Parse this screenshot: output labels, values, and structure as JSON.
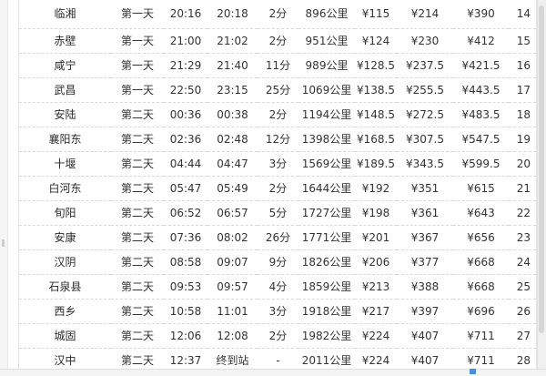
{
  "columns": [
    "station",
    "day",
    "arrive",
    "depart",
    "stop",
    "distance",
    "price1",
    "price2",
    "price3",
    "index"
  ],
  "rows": [
    {
      "station": "临湘",
      "day": "第一天",
      "arrive": "20:16",
      "depart": "20:18",
      "stop": "2分",
      "distance": "896公里",
      "price1": "¥115",
      "price2": "¥214",
      "price3": "¥390",
      "index": "14"
    },
    {
      "station": "赤壁",
      "day": "第一天",
      "arrive": "21:00",
      "depart": "21:02",
      "stop": "2分",
      "distance": "951公里",
      "price1": "¥124",
      "price2": "¥230",
      "price3": "¥412",
      "index": "15"
    },
    {
      "station": "咸宁",
      "day": "第一天",
      "arrive": "21:29",
      "depart": "21:40",
      "stop": "11分",
      "distance": "989公里",
      "price1": "¥128.5",
      "price2": "¥237.5",
      "price3": "¥421.5",
      "index": "16"
    },
    {
      "station": "武昌",
      "day": "第一天",
      "arrive": "22:50",
      "depart": "23:15",
      "stop": "25分",
      "distance": "1069公里",
      "price1": "¥138.5",
      "price2": "¥255.5",
      "price3": "¥443.5",
      "index": "17"
    },
    {
      "station": "安陆",
      "day": "第二天",
      "arrive": "00:36",
      "depart": "00:38",
      "stop": "2分",
      "distance": "1194公里",
      "price1": "¥148.5",
      "price2": "¥272.5",
      "price3": "¥483.5",
      "index": "18"
    },
    {
      "station": "襄阳东",
      "day": "第二天",
      "arrive": "02:36",
      "depart": "02:48",
      "stop": "12分",
      "distance": "1398公里",
      "price1": "¥168.5",
      "price2": "¥307.5",
      "price3": "¥547.5",
      "index": "19"
    },
    {
      "station": "十堰",
      "day": "第二天",
      "arrive": "04:44",
      "depart": "04:47",
      "stop": "3分",
      "distance": "1569公里",
      "price1": "¥189.5",
      "price2": "¥343.5",
      "price3": "¥599.5",
      "index": "20"
    },
    {
      "station": "白河东",
      "day": "第二天",
      "arrive": "05:47",
      "depart": "05:49",
      "stop": "2分",
      "distance": "1644公里",
      "price1": "¥192",
      "price2": "¥351",
      "price3": "¥615",
      "index": "21"
    },
    {
      "station": "旬阳",
      "day": "第二天",
      "arrive": "06:52",
      "depart": "06:57",
      "stop": "5分",
      "distance": "1727公里",
      "price1": "¥198",
      "price2": "¥361",
      "price3": "¥643",
      "index": "22"
    },
    {
      "station": "安康",
      "day": "第二天",
      "arrive": "07:36",
      "depart": "08:02",
      "stop": "26分",
      "distance": "1771公里",
      "price1": "¥201",
      "price2": "¥367",
      "price3": "¥656",
      "index": "23"
    },
    {
      "station": "汉阴",
      "day": "第二天",
      "arrive": "08:58",
      "depart": "09:07",
      "stop": "9分",
      "distance": "1826公里",
      "price1": "¥206",
      "price2": "¥377",
      "price3": "¥668",
      "index": "24"
    },
    {
      "station": "石泉县",
      "day": "第二天",
      "arrive": "09:53",
      "depart": "09:57",
      "stop": "4分",
      "distance": "1859公里",
      "price1": "¥213",
      "price2": "¥388",
      "price3": "¥668",
      "index": "25"
    },
    {
      "station": "西乡",
      "day": "第二天",
      "arrive": "10:58",
      "depart": "11:01",
      "stop": "3分",
      "distance": "1918公里",
      "price1": "¥217",
      "price2": "¥397",
      "price3": "¥696",
      "index": "26"
    },
    {
      "station": "城固",
      "day": "第二天",
      "arrive": "12:06",
      "depart": "12:08",
      "stop": "2分",
      "distance": "1982公里",
      "price1": "¥224",
      "price2": "¥407",
      "price3": "¥711",
      "index": "27"
    },
    {
      "station": "汉中",
      "day": "第二天",
      "arrive": "12:37",
      "depart": "终到站",
      "stop": "-",
      "distance": "2011公里",
      "price1": "¥224",
      "price2": "¥407",
      "price3": "¥711",
      "index": "28"
    }
  ]
}
